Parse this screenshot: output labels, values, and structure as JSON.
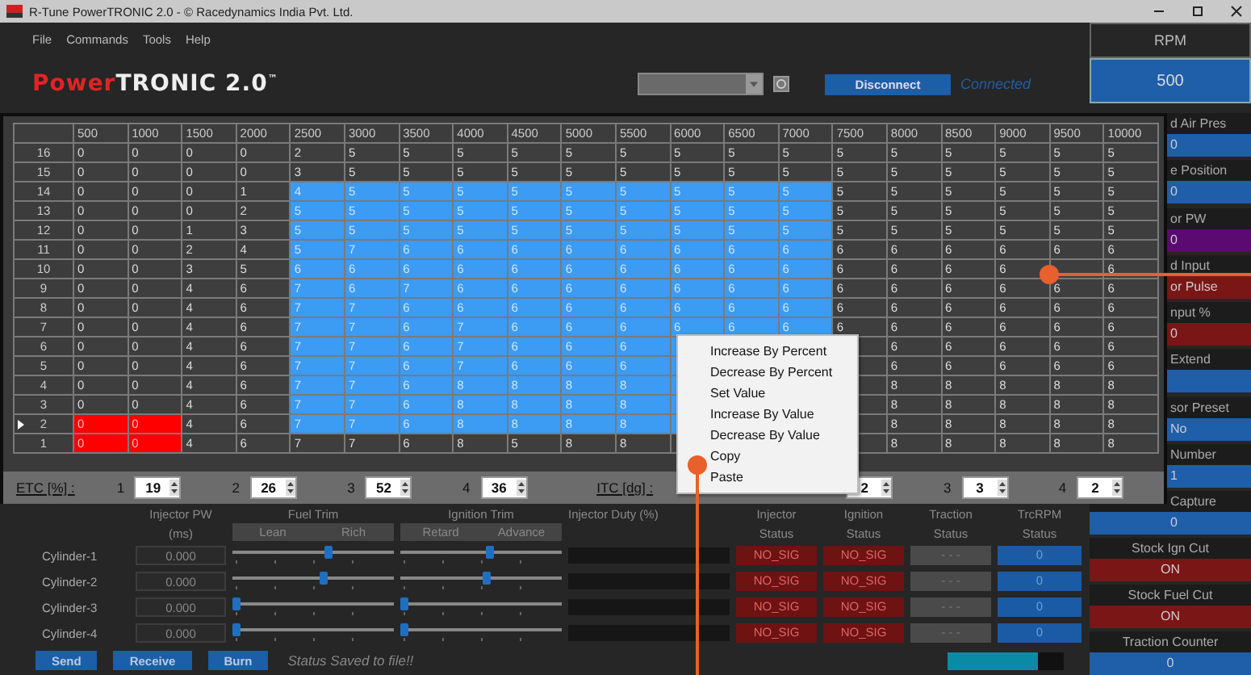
{
  "window": {
    "title": "R-Tune PowerTRONIC 2.0 - © Racedynamics India Pvt. Ltd."
  },
  "menu": [
    "File",
    "Commands",
    "Tools",
    "Help"
  ],
  "logo": {
    "accent": "Power",
    "main": "TRONIC 2.0",
    "mark": "™"
  },
  "connect_button": "Disconnect",
  "connection_status": "Connected",
  "rpm": {
    "label": "RPM",
    "value": "500"
  },
  "gauges_behind_map": [
    {
      "label": "d Air Pres",
      "value": "0",
      "color": "#1f5ea8"
    },
    {
      "label": "e Position",
      "value": "0",
      "color": "#1f5ea8"
    },
    {
      "label": "or PW",
      "value": "0",
      "color": "#5a0a70"
    },
    {
      "label": "d Input",
      "value": "or Pulse",
      "color": "#7a1616"
    },
    {
      "label": "nput %",
      "value": "0",
      "color": "#7a1616"
    },
    {
      "label": "Extend",
      "color": "#1f5ea8"
    },
    {
      "label": "sor Preset",
      "value": "No",
      "color": "#1f5ea8"
    },
    {
      "label": "Number",
      "value": "1",
      "color": "#1f5ea8"
    },
    {
      "label": "Capture",
      "value": "0",
      "color": "#1f5ea8"
    }
  ],
  "gauges": [
    {
      "label": "Stock Ign Cut",
      "value": "ON",
      "color": "#7a1616"
    },
    {
      "label": "Stock Fuel Cut",
      "value": "ON",
      "color": "#7a1616"
    },
    {
      "label": "Traction Counter",
      "value": "0",
      "color": "#1f5ea8"
    }
  ],
  "map": {
    "columns": [
      "500",
      "1000",
      "1500",
      "2000",
      "2500",
      "3000",
      "3500",
      "4000",
      "4500",
      "5000",
      "5500",
      "6000",
      "6500",
      "7000",
      "7500",
      "8000",
      "8500",
      "9000",
      "9500",
      "10000"
    ],
    "rows": [
      {
        "label": "16",
        "current": false,
        "cells": [
          {
            "value": "0",
            "selected": false,
            "flagged": false
          },
          {
            "value": "0",
            "selected": false,
            "flagged": false
          },
          {
            "value": "0",
            "selected": false,
            "flagged": false
          },
          {
            "value": "0",
            "selected": false,
            "flagged": false
          },
          {
            "value": "2",
            "selected": false,
            "flagged": false
          },
          {
            "value": "5",
            "selected": false,
            "flagged": false
          },
          {
            "value": "5",
            "selected": false,
            "flagged": false
          },
          {
            "value": "5",
            "selected": false,
            "flagged": false
          },
          {
            "value": "5",
            "selected": false,
            "flagged": false
          },
          {
            "value": "5",
            "selected": false,
            "flagged": false
          },
          {
            "value": "5",
            "selected": false,
            "flagged": false
          },
          {
            "value": "5",
            "selected": false,
            "flagged": false
          },
          {
            "value": "5",
            "selected": false,
            "flagged": false
          },
          {
            "value": "5",
            "selected": false,
            "flagged": false
          },
          {
            "value": "5",
            "selected": false,
            "flagged": false
          },
          {
            "value": "5",
            "selected": false,
            "flagged": false
          },
          {
            "value": "5",
            "selected": false,
            "flagged": false
          },
          {
            "value": "5",
            "selected": false,
            "flagged": false
          },
          {
            "value": "5",
            "selected": false,
            "flagged": false
          },
          {
            "value": "5",
            "selected": false,
            "flagged": false
          }
        ]
      },
      {
        "label": "15",
        "current": false,
        "cells": [
          {
            "value": "0",
            "selected": false,
            "flagged": false
          },
          {
            "value": "0",
            "selected": false,
            "flagged": false
          },
          {
            "value": "0",
            "selected": false,
            "flagged": false
          },
          {
            "value": "0",
            "selected": false,
            "flagged": false
          },
          {
            "value": "3",
            "selected": false,
            "flagged": false
          },
          {
            "value": "5",
            "selected": false,
            "flagged": false
          },
          {
            "value": "5",
            "selected": false,
            "flagged": false
          },
          {
            "value": "5",
            "selected": false,
            "flagged": false
          },
          {
            "value": "5",
            "selected": false,
            "flagged": false
          },
          {
            "value": "5",
            "selected": false,
            "flagged": false
          },
          {
            "value": "5",
            "selected": false,
            "flagged": false
          },
          {
            "value": "5",
            "selected": false,
            "flagged": false
          },
          {
            "value": "5",
            "selected": false,
            "flagged": false
          },
          {
            "value": "5",
            "selected": false,
            "flagged": false
          },
          {
            "value": "5",
            "selected": false,
            "flagged": false
          },
          {
            "value": "5",
            "selected": false,
            "flagged": false
          },
          {
            "value": "5",
            "selected": false,
            "flagged": false
          },
          {
            "value": "5",
            "selected": false,
            "flagged": false
          },
          {
            "value": "5",
            "selected": false,
            "flagged": false
          },
          {
            "value": "5",
            "selected": false,
            "flagged": false
          }
        ]
      },
      {
        "label": "14",
        "current": false,
        "cells": [
          {
            "value": "0",
            "selected": false,
            "flagged": false
          },
          {
            "value": "0",
            "selected": false,
            "flagged": false
          },
          {
            "value": "0",
            "selected": false,
            "flagged": false
          },
          {
            "value": "1",
            "selected": false,
            "flagged": false
          },
          {
            "value": "4",
            "selected": true,
            "flagged": false
          },
          {
            "value": "5",
            "selected": true,
            "flagged": false
          },
          {
            "value": "5",
            "selected": true,
            "flagged": false
          },
          {
            "value": "5",
            "selected": true,
            "flagged": false
          },
          {
            "value": "5",
            "selected": true,
            "flagged": false
          },
          {
            "value": "5",
            "selected": true,
            "flagged": false
          },
          {
            "value": "5",
            "selected": true,
            "flagged": false
          },
          {
            "value": "5",
            "selected": true,
            "flagged": false
          },
          {
            "value": "5",
            "selected": true,
            "flagged": false
          },
          {
            "value": "5",
            "selected": true,
            "flagged": false
          },
          {
            "value": "5",
            "selected": false,
            "flagged": false
          },
          {
            "value": "5",
            "selected": false,
            "flagged": false
          },
          {
            "value": "5",
            "selected": false,
            "flagged": false
          },
          {
            "value": "5",
            "selected": false,
            "flagged": false
          },
          {
            "value": "5",
            "selected": false,
            "flagged": false
          },
          {
            "value": "5",
            "selected": false,
            "flagged": false
          }
        ]
      },
      {
        "label": "13",
        "current": false,
        "cells": [
          {
            "value": "0",
            "selected": false,
            "flagged": false
          },
          {
            "value": "0",
            "selected": false,
            "flagged": false
          },
          {
            "value": "0",
            "selected": false,
            "flagged": false
          },
          {
            "value": "2",
            "selected": false,
            "flagged": false
          },
          {
            "value": "5",
            "selected": true,
            "flagged": false
          },
          {
            "value": "5",
            "selected": true,
            "flagged": false
          },
          {
            "value": "5",
            "selected": true,
            "flagged": false
          },
          {
            "value": "5",
            "selected": true,
            "flagged": false
          },
          {
            "value": "5",
            "selected": true,
            "flagged": false
          },
          {
            "value": "5",
            "selected": true,
            "flagged": false
          },
          {
            "value": "5",
            "selected": true,
            "flagged": false
          },
          {
            "value": "5",
            "selected": true,
            "flagged": false
          },
          {
            "value": "5",
            "selected": true,
            "flagged": false
          },
          {
            "value": "5",
            "selected": true,
            "flagged": false
          },
          {
            "value": "5",
            "selected": false,
            "flagged": false
          },
          {
            "value": "5",
            "selected": false,
            "flagged": false
          },
          {
            "value": "5",
            "selected": false,
            "flagged": false
          },
          {
            "value": "5",
            "selected": false,
            "flagged": false
          },
          {
            "value": "5",
            "selected": false,
            "flagged": false
          },
          {
            "value": "5",
            "selected": false,
            "flagged": false
          }
        ]
      },
      {
        "label": "12",
        "current": false,
        "cells": [
          {
            "value": "0",
            "selected": false,
            "flagged": false
          },
          {
            "value": "0",
            "selected": false,
            "flagged": false
          },
          {
            "value": "1",
            "selected": false,
            "flagged": false
          },
          {
            "value": "3",
            "selected": false,
            "flagged": false
          },
          {
            "value": "5",
            "selected": true,
            "flagged": false
          },
          {
            "value": "5",
            "selected": true,
            "flagged": false
          },
          {
            "value": "5",
            "selected": true,
            "flagged": false
          },
          {
            "value": "5",
            "selected": true,
            "flagged": false
          },
          {
            "value": "5",
            "selected": true,
            "flagged": false
          },
          {
            "value": "5",
            "selected": true,
            "flagged": false
          },
          {
            "value": "5",
            "selected": true,
            "flagged": false
          },
          {
            "value": "5",
            "selected": true,
            "flagged": false
          },
          {
            "value": "5",
            "selected": true,
            "flagged": false
          },
          {
            "value": "5",
            "selected": true,
            "flagged": false
          },
          {
            "value": "5",
            "selected": false,
            "flagged": false
          },
          {
            "value": "5",
            "selected": false,
            "flagged": false
          },
          {
            "value": "5",
            "selected": false,
            "flagged": false
          },
          {
            "value": "5",
            "selected": false,
            "flagged": false
          },
          {
            "value": "5",
            "selected": false,
            "flagged": false
          },
          {
            "value": "5",
            "selected": false,
            "flagged": false
          }
        ]
      },
      {
        "label": "11",
        "current": false,
        "cells": [
          {
            "value": "0",
            "selected": false,
            "flagged": false
          },
          {
            "value": "0",
            "selected": false,
            "flagged": false
          },
          {
            "value": "2",
            "selected": false,
            "flagged": false
          },
          {
            "value": "4",
            "selected": false,
            "flagged": false
          },
          {
            "value": "5",
            "selected": true,
            "flagged": false
          },
          {
            "value": "7",
            "selected": true,
            "flagged": false
          },
          {
            "value": "6",
            "selected": true,
            "flagged": false
          },
          {
            "value": "6",
            "selected": true,
            "flagged": false
          },
          {
            "value": "6",
            "selected": true,
            "flagged": false
          },
          {
            "value": "6",
            "selected": true,
            "flagged": false
          },
          {
            "value": "6",
            "selected": true,
            "flagged": false
          },
          {
            "value": "6",
            "selected": true,
            "flagged": false
          },
          {
            "value": "6",
            "selected": true,
            "flagged": false
          },
          {
            "value": "6",
            "selected": true,
            "flagged": false
          },
          {
            "value": "6",
            "selected": false,
            "flagged": false
          },
          {
            "value": "6",
            "selected": false,
            "flagged": false
          },
          {
            "value": "6",
            "selected": false,
            "flagged": false
          },
          {
            "value": "6",
            "selected": false,
            "flagged": false
          },
          {
            "value": "6",
            "selected": false,
            "flagged": false
          },
          {
            "value": "6",
            "selected": false,
            "flagged": false
          }
        ]
      },
      {
        "label": "10",
        "current": false,
        "cells": [
          {
            "value": "0",
            "selected": false,
            "flagged": false
          },
          {
            "value": "0",
            "selected": false,
            "flagged": false
          },
          {
            "value": "3",
            "selected": false,
            "flagged": false
          },
          {
            "value": "5",
            "selected": false,
            "flagged": false
          },
          {
            "value": "6",
            "selected": true,
            "flagged": false
          },
          {
            "value": "6",
            "selected": true,
            "flagged": false
          },
          {
            "value": "6",
            "selected": true,
            "flagged": false
          },
          {
            "value": "6",
            "selected": true,
            "flagged": false
          },
          {
            "value": "6",
            "selected": true,
            "flagged": false
          },
          {
            "value": "6",
            "selected": true,
            "flagged": false
          },
          {
            "value": "6",
            "selected": true,
            "flagged": false
          },
          {
            "value": "6",
            "selected": true,
            "flagged": false
          },
          {
            "value": "6",
            "selected": true,
            "flagged": false
          },
          {
            "value": "6",
            "selected": true,
            "flagged": false
          },
          {
            "value": "6",
            "selected": false,
            "flagged": false
          },
          {
            "value": "6",
            "selected": false,
            "flagged": false
          },
          {
            "value": "6",
            "selected": false,
            "flagged": false
          },
          {
            "value": "6",
            "selected": false,
            "flagged": false
          },
          {
            "selected": false,
            "flagged": false
          },
          {
            "value": "6",
            "selected": false,
            "flagged": false
          }
        ]
      },
      {
        "label": "9",
        "current": false,
        "cells": [
          {
            "value": "0",
            "selected": false,
            "flagged": false
          },
          {
            "value": "0",
            "selected": false,
            "flagged": false
          },
          {
            "value": "4",
            "selected": false,
            "flagged": false
          },
          {
            "value": "6",
            "selected": false,
            "flagged": false
          },
          {
            "value": "7",
            "selected": true,
            "flagged": false
          },
          {
            "value": "6",
            "selected": true,
            "flagged": false
          },
          {
            "value": "7",
            "selected": true,
            "flagged": false
          },
          {
            "value": "6",
            "selected": true,
            "flagged": false
          },
          {
            "value": "6",
            "selected": true,
            "flagged": false
          },
          {
            "value": "6",
            "selected": true,
            "flagged": false
          },
          {
            "value": "6",
            "selected": true,
            "flagged": false
          },
          {
            "value": "6",
            "selected": true,
            "flagged": false
          },
          {
            "value": "6",
            "selected": true,
            "flagged": false
          },
          {
            "value": "6",
            "selected": true,
            "flagged": false
          },
          {
            "value": "6",
            "selected": false,
            "flagged": false
          },
          {
            "value": "6",
            "selected": false,
            "flagged": false
          },
          {
            "value": "6",
            "selected": false,
            "flagged": false
          },
          {
            "value": "6",
            "selected": false,
            "flagged": false
          },
          {
            "value": "6",
            "selected": false,
            "flagged": false
          },
          {
            "value": "6",
            "selected": false,
            "flagged": false
          }
        ]
      },
      {
        "label": "8",
        "current": false,
        "cells": [
          {
            "value": "0",
            "selected": false,
            "flagged": false
          },
          {
            "value": "0",
            "selected": false,
            "flagged": false
          },
          {
            "value": "4",
            "selected": false,
            "flagged": false
          },
          {
            "value": "6",
            "selected": false,
            "flagged": false
          },
          {
            "value": "7",
            "selected": true,
            "flagged": false
          },
          {
            "value": "7",
            "selected": true,
            "flagged": false
          },
          {
            "value": "6",
            "selected": true,
            "flagged": false
          },
          {
            "value": "6",
            "selected": true,
            "flagged": false
          },
          {
            "value": "6",
            "selected": true,
            "flagged": false
          },
          {
            "value": "6",
            "selected": true,
            "flagged": false
          },
          {
            "value": "6",
            "selected": true,
            "flagged": false
          },
          {
            "value": "6",
            "selected": true,
            "flagged": false
          },
          {
            "value": "6",
            "selected": true,
            "flagged": false
          },
          {
            "value": "6",
            "selected": true,
            "flagged": false
          },
          {
            "value": "6",
            "selected": false,
            "flagged": false
          },
          {
            "value": "6",
            "selected": false,
            "flagged": false
          },
          {
            "value": "6",
            "selected": false,
            "flagged": false
          },
          {
            "value": "6",
            "selected": false,
            "flagged": false
          },
          {
            "value": "6",
            "selected": false,
            "flagged": false
          },
          {
            "value": "6",
            "selected": false,
            "flagged": false
          }
        ]
      },
      {
        "label": "7",
        "current": false,
        "cells": [
          {
            "value": "0",
            "selected": false,
            "flagged": false
          },
          {
            "value": "0",
            "selected": false,
            "flagged": false
          },
          {
            "value": "4",
            "selected": false,
            "flagged": false
          },
          {
            "value": "6",
            "selected": false,
            "flagged": false
          },
          {
            "value": "7",
            "selected": true,
            "flagged": false
          },
          {
            "value": "7",
            "selected": true,
            "flagged": false
          },
          {
            "value": "6",
            "selected": true,
            "flagged": false
          },
          {
            "value": "7",
            "selected": true,
            "flagged": false
          },
          {
            "value": "6",
            "selected": true,
            "flagged": false
          },
          {
            "value": "6",
            "selected": true,
            "flagged": false
          },
          {
            "value": "6",
            "selected": true,
            "flagged": false
          },
          {
            "value": "6",
            "selected": true,
            "flagged": false
          },
          {
            "value": "6",
            "selected": true,
            "flagged": false
          },
          {
            "value": "6",
            "selected": true,
            "flagged": false
          },
          {
            "value": "6",
            "selected": false,
            "flagged": false
          },
          {
            "value": "6",
            "selected": false,
            "flagged": false
          },
          {
            "value": "6",
            "selected": false,
            "flagged": false
          },
          {
            "value": "6",
            "selected": false,
            "flagged": false
          },
          {
            "value": "6",
            "selected": false,
            "flagged": false
          },
          {
            "value": "6",
            "selected": false,
            "flagged": false
          }
        ]
      },
      {
        "label": "6",
        "current": false,
        "cells": [
          {
            "value": "0",
            "selected": false,
            "flagged": false
          },
          {
            "value": "0",
            "selected": false,
            "flagged": false
          },
          {
            "value": "4",
            "selected": false,
            "flagged": false
          },
          {
            "value": "6",
            "selected": false,
            "flagged": false
          },
          {
            "value": "7",
            "selected": true,
            "flagged": false
          },
          {
            "value": "7",
            "selected": true,
            "flagged": false
          },
          {
            "value": "6",
            "selected": true,
            "flagged": false
          },
          {
            "value": "7",
            "selected": true,
            "flagged": false
          },
          {
            "value": "6",
            "selected": true,
            "flagged": false
          },
          {
            "value": "6",
            "selected": true,
            "flagged": false
          },
          {
            "value": "6",
            "selected": true,
            "flagged": false
          },
          {
            "selected": true,
            "flagged": false
          },
          {},
          {},
          {
            "selected": false,
            "flagged": false
          },
          {
            "value": "6",
            "selected": false,
            "flagged": false
          },
          {
            "value": "6",
            "selected": false,
            "flagged": false
          },
          {
            "value": "6",
            "selected": false,
            "flagged": false
          },
          {
            "value": "6",
            "selected": false,
            "flagged": false
          },
          {
            "value": "6",
            "selected": false,
            "flagged": false
          }
        ]
      },
      {
        "label": "5",
        "current": false,
        "cells": [
          {
            "value": "0",
            "selected": false,
            "flagged": false
          },
          {
            "value": "0",
            "selected": false,
            "flagged": false
          },
          {
            "value": "4",
            "selected": false,
            "flagged": false
          },
          {
            "value": "6",
            "selected": false,
            "flagged": false
          },
          {
            "value": "7",
            "selected": true,
            "flagged": false
          },
          {
            "value": "7",
            "selected": true,
            "flagged": false
          },
          {
            "value": "6",
            "selected": true,
            "flagged": false
          },
          {
            "value": "7",
            "selected": true,
            "flagged": false
          },
          {
            "value": "6",
            "selected": true,
            "flagged": false
          },
          {
            "value": "6",
            "selected": true,
            "flagged": false
          },
          {
            "value": "6",
            "selected": true,
            "flagged": false
          },
          {
            "selected": true,
            "flagged": false
          },
          {},
          {},
          {
            "selected": false,
            "flagged": false
          },
          {
            "value": "6",
            "selected": false,
            "flagged": false
          },
          {
            "value": "6",
            "selected": false,
            "flagged": false
          },
          {
            "value": "6",
            "selected": false,
            "flagged": false
          },
          {
            "value": "6",
            "selected": false,
            "flagged": false
          },
          {
            "value": "6",
            "selected": false,
            "flagged": false
          }
        ]
      },
      {
        "label": "4",
        "current": false,
        "cells": [
          {
            "value": "0",
            "selected": false,
            "flagged": false
          },
          {
            "value": "0",
            "selected": false,
            "flagged": false
          },
          {
            "value": "4",
            "selected": false,
            "flagged": false
          },
          {
            "value": "6",
            "selected": false,
            "flagged": false
          },
          {
            "value": "7",
            "selected": true,
            "flagged": false
          },
          {
            "value": "7",
            "selected": true,
            "flagged": false
          },
          {
            "value": "6",
            "selected": true,
            "flagged": false
          },
          {
            "value": "8",
            "selected": true,
            "flagged": false
          },
          {
            "value": "8",
            "selected": true,
            "flagged": false
          },
          {
            "value": "8",
            "selected": true,
            "flagged": false
          },
          {
            "value": "8",
            "selected": true,
            "flagged": false
          },
          {
            "selected": true,
            "flagged": false
          },
          {},
          {},
          {
            "selected": false,
            "flagged": false
          },
          {
            "value": "8",
            "selected": false,
            "flagged": false
          },
          {
            "value": "8",
            "selected": false,
            "flagged": false
          },
          {
            "value": "8",
            "selected": false,
            "flagged": false
          },
          {
            "value": "8",
            "selected": false,
            "flagged": false
          },
          {
            "value": "8",
            "selected": false,
            "flagged": false
          }
        ]
      },
      {
        "label": "3",
        "current": false,
        "cells": [
          {
            "value": "0",
            "selected": false,
            "flagged": false
          },
          {
            "value": "0",
            "selected": false,
            "flagged": false
          },
          {
            "value": "4",
            "selected": false,
            "flagged": false
          },
          {
            "value": "6",
            "selected": false,
            "flagged": false
          },
          {
            "value": "7",
            "selected": true,
            "flagged": false
          },
          {
            "value": "7",
            "selected": true,
            "flagged": false
          },
          {
            "value": "6",
            "selected": true,
            "flagged": false
          },
          {
            "value": "8",
            "selected": true,
            "flagged": false
          },
          {
            "value": "8",
            "selected": true,
            "flagged": false
          },
          {
            "value": "8",
            "selected": true,
            "flagged": false
          },
          {
            "value": "8",
            "selected": true,
            "flagged": false
          },
          {
            "selected": true,
            "flagged": false
          },
          {},
          {},
          {
            "selected": false,
            "flagged": false
          },
          {
            "value": "8",
            "selected": false,
            "flagged": false
          },
          {
            "value": "8",
            "selected": false,
            "flagged": false
          },
          {
            "value": "8",
            "selected": false,
            "flagged": false
          },
          {
            "value": "8",
            "selected": false,
            "flagged": false
          },
          {
            "value": "8",
            "selected": false,
            "flagged": false
          }
        ]
      },
      {
        "label": "2",
        "current": true,
        "cells": [
          {
            "value": "0",
            "selected": false,
            "flagged": true
          },
          {
            "value": "0",
            "selected": false,
            "flagged": true
          },
          {
            "value": "4",
            "selected": false,
            "flagged": false
          },
          {
            "value": "6",
            "selected": false,
            "flagged": false
          },
          {
            "value": "7",
            "selected": true,
            "flagged": false
          },
          {
            "value": "7",
            "selected": true,
            "flagged": false
          },
          {
            "value": "6",
            "selected": true,
            "flagged": false
          },
          {
            "value": "8",
            "selected": true,
            "flagged": false
          },
          {
            "value": "8",
            "selected": true,
            "flagged": false
          },
          {
            "value": "8",
            "selected": true,
            "flagged": false
          },
          {
            "value": "8",
            "selected": true,
            "flagged": false
          },
          {
            "selected": true,
            "flagged": false
          },
          {},
          {},
          {
            "selected": false,
            "flagged": false
          },
          {
            "value": "8",
            "selected": false,
            "flagged": false
          },
          {
            "value": "8",
            "selected": false,
            "flagged": false
          },
          {
            "value": "8",
            "selected": false,
            "flagged": false
          },
          {
            "value": "8",
            "selected": false,
            "flagged": false
          },
          {
            "value": "8",
            "selected": false,
            "flagged": false
          }
        ]
      },
      {
        "label": "1",
        "current": false,
        "cells": [
          {
            "value": "0",
            "selected": false,
            "flagged": true
          },
          {
            "value": "0",
            "selected": false,
            "flagged": true
          },
          {
            "value": "4",
            "selected": false,
            "flagged": false
          },
          {
            "value": "6",
            "selected": false,
            "flagged": false
          },
          {
            "value": "7",
            "selected": false,
            "flagged": false
          },
          {
            "value": "7",
            "selected": false,
            "flagged": false
          },
          {
            "value": "6",
            "selected": false,
            "flagged": false
          },
          {
            "value": "8",
            "selected": false,
            "flagged": false
          },
          {
            "value": "5",
            "selected": false,
            "flagged": false
          },
          {
            "value": "8",
            "selected": false,
            "flagged": false
          },
          {
            "value": "8",
            "selected": false,
            "flagged": false
          },
          {
            "selected": false,
            "flagged": false
          },
          {},
          {},
          {
            "selected": false,
            "flagged": false
          },
          {
            "value": "8",
            "selected": false,
            "flagged": false
          },
          {
            "value": "8",
            "selected": false,
            "flagged": false
          },
          {
            "value": "8",
            "selected": false,
            "flagged": false
          },
          {
            "value": "8",
            "selected": false,
            "flagged": false
          },
          {
            "value": "8",
            "selected": false,
            "flagged": false
          }
        ]
      }
    ]
  },
  "etc": {
    "label": "ETC [%] :",
    "inputs": [
      {
        "index": "1",
        "value": "19"
      },
      {
        "index": "2",
        "value": "26"
      },
      {
        "index": "3",
        "value": "52"
      },
      {
        "index": "4",
        "value": "36"
      }
    ]
  },
  "itc": {
    "label": "ITC [dg] :",
    "inputs": [
      {
        "value": "2"
      },
      {
        "index": "3",
        "value": "3"
      },
      {
        "index": "4",
        "value": "2"
      }
    ]
  },
  "context_menu": [
    "Increase By Percent",
    "Decrease By Percent",
    "Set Value",
    "Increase By Value",
    "Decrease By Value",
    "Copy",
    "Paste"
  ],
  "trim_panel": {
    "injector_pw_header": "Injector PW",
    "injector_pw_unit": "(ms)",
    "fuel_trim_header": "Fuel Trim",
    "fuel_trim_buttons": [
      "Lean",
      "Rich"
    ],
    "ignition_trim_header": "Ignition Trim",
    "ignition_trim_buttons": [
      "Retard",
      "Advance"
    ],
    "injector_duty_header": "Injector Duty (%)",
    "status_columns": [
      {
        "title": "Injector",
        "subtitle": "Status"
      },
      {
        "title": "Ignition",
        "subtitle": "Status"
      },
      {
        "title": "Traction",
        "subtitle": "Status"
      },
      {
        "title": "TrcRPM",
        "subtitle": "Status"
      }
    ],
    "cylinders": [
      {
        "name": "Cylinder-1",
        "pw": "0.000",
        "fuel_trim": {
          "level": 0.6
        },
        "ignition_trim": {
          "level": 0.56
        },
        "statuses": [
          "NO_SIG",
          "NO_SIG",
          "- - -",
          "0"
        ]
      },
      {
        "name": "Cylinder-2",
        "pw": "0.000",
        "fuel_trim": {
          "level": 0.57
        },
        "ignition_trim": {
          "level": 0.54
        },
        "statuses": [
          "NO_SIG",
          "NO_SIG",
          "- - -",
          "0"
        ]
      },
      {
        "name": "Cylinder-3",
        "pw": "0.000",
        "fuel_trim": {
          "level": 0
        },
        "ignition_trim": {
          "level": 0
        },
        "statuses": [
          "NO_SIG",
          "NO_SIG",
          "- - -",
          "0"
        ]
      },
      {
        "name": "Cylinder-4",
        "pw": "0.000",
        "fuel_trim": {
          "level": 0
        },
        "ignition_trim": {
          "level": 0
        },
        "statuses": [
          "NO_SIG",
          "NO_SIG",
          "- - -",
          "0"
        ]
      }
    ]
  },
  "actions": [
    "Send",
    "Receive",
    "Burn"
  ],
  "status_text": "Status Saved to file!!",
  "progress": {
    "level": 0.78
  }
}
